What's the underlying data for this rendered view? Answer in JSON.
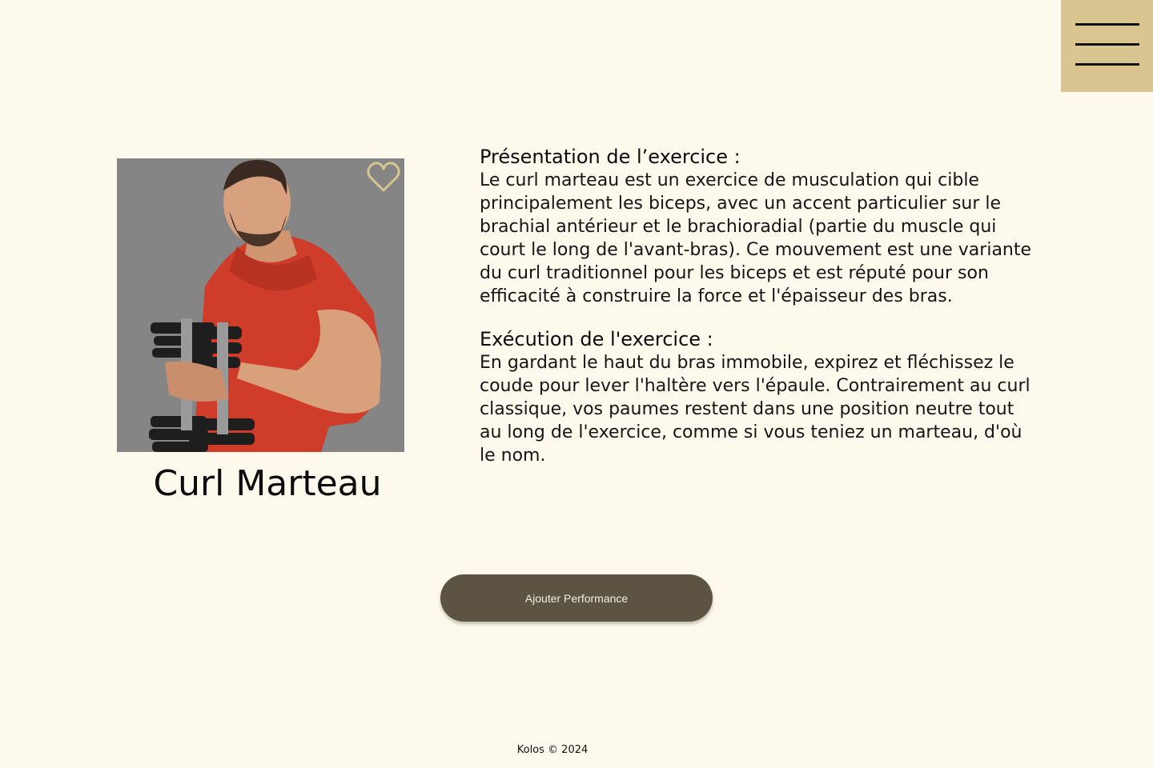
{
  "header": {
    "menu_icon": "hamburger-menu-icon"
  },
  "exercise": {
    "title": "Curl Marteau",
    "favorite_icon": "heart-outline-icon",
    "accent_color": "#d9c590",
    "presentation_heading": "Présentation de l’exercice :",
    "presentation_body": "Le curl marteau est un exercice de musculation qui cible principalement les biceps, avec un accent particulier sur le brachial antérieur et le brachioradial (partie du muscle qui court le long de l'avant-bras). Ce mouvement est une variante du curl traditionnel pour les biceps et est réputé pour son efficacité à construire la force et l'épaisseur des bras.",
    "execution_heading": "Exécution de l'exercice :",
    "execution_body": "En gardant le haut du bras immobile, expirez et fléchissez le coude pour lever l'haltère vers l'épaule. Contrairement au curl classique, vos paumes restent dans une position neutre tout au long de l'exercice, comme si vous teniez un marteau, d'où le nom."
  },
  "actions": {
    "add_performance_label": "Ajouter Performance",
    "button_color": "#5c5343"
  },
  "footer": {
    "copyright": "Kolos © 2024"
  }
}
